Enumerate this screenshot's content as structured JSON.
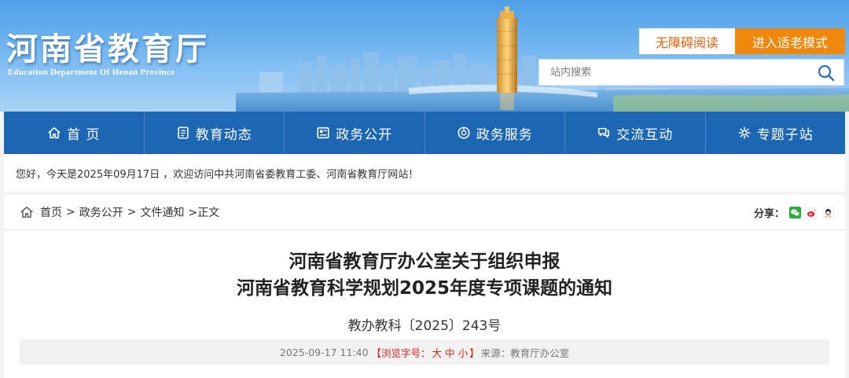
{
  "header": {
    "title": "河南省教育厅",
    "subtitle": "Education Department Of Henan Province",
    "accessible_button": "无障碍阅读",
    "elderly_button": "进入适老模式",
    "search": {
      "placeholder": "站内搜索"
    }
  },
  "nav": {
    "items": [
      {
        "label": "首 页",
        "icon": "home-icon"
      },
      {
        "label": "教育动态",
        "icon": "news-icon"
      },
      {
        "label": "政务公开",
        "icon": "document-icon"
      },
      {
        "label": "政务服务",
        "icon": "service-icon"
      },
      {
        "label": "交流互动",
        "icon": "interaction-icon"
      },
      {
        "label": "专题子站",
        "icon": "topic-icon"
      }
    ]
  },
  "welcome": {
    "text": "您好，今天是2025年09月17日 ，欢迎访问中共河南省委教育工委、河南省教育厅网站！"
  },
  "breadcrumb": {
    "items": [
      "首页",
      "政务公开",
      "文件通知"
    ],
    "current": ">正文"
  },
  "share": {
    "label": "分享：",
    "icons": [
      "wechat-icon",
      "weibo-icon",
      "qq-icon"
    ]
  },
  "article": {
    "title_line1": "河南省教育厅办公室关于组织申报",
    "title_line2": "河南省教育科学规划2025年度专项课题的通知",
    "doc_number": "教办教科〔2025〕243号",
    "datetime": "2025-09-17 11:40",
    "font_size_label_open": "【浏览字号：",
    "font_sizes": [
      "大",
      "中",
      "小"
    ],
    "font_size_label_close": "】",
    "source": "来源：教育厅办公室"
  },
  "colors": {
    "nav_bg": "#1d66b4",
    "accent_orange": "#f0870d",
    "accessible_text": "#e5600c",
    "font_size_red": "#d8221b"
  }
}
